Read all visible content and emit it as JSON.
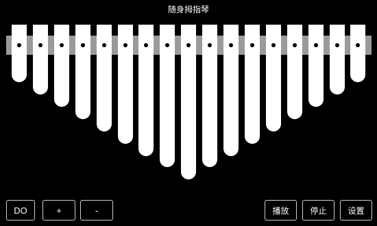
{
  "app": {
    "title": "随身拇指琴"
  },
  "kalimba": {
    "tine_count": 17,
    "tine_lengths": [
      84,
      102,
      120,
      138,
      156,
      174,
      192,
      208,
      226,
      208,
      192,
      174,
      156,
      138,
      120,
      102,
      84
    ]
  },
  "controls": {
    "key_label": "DO",
    "plus_label": "+",
    "minus_label": "-",
    "play_label": "播放",
    "stop_label": "停止",
    "settings_label": "设置"
  }
}
